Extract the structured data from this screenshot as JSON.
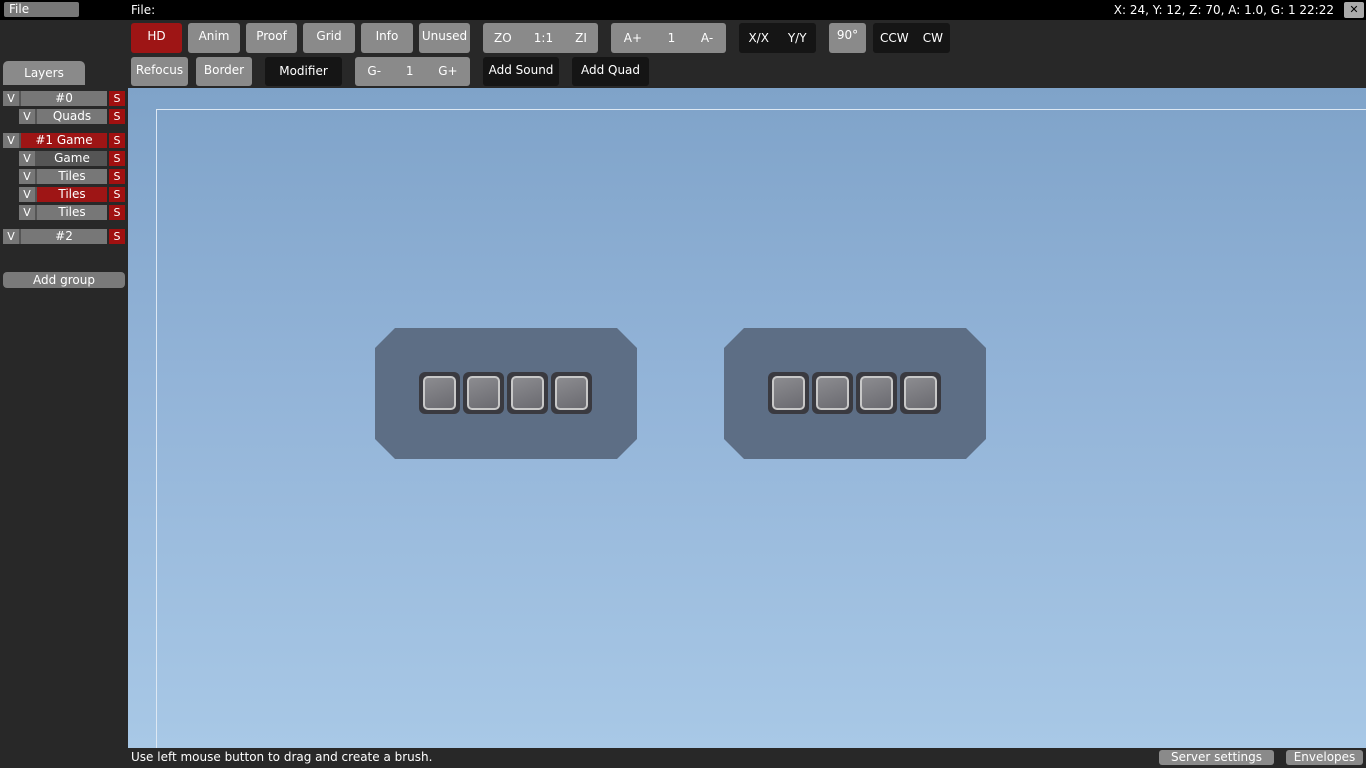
{
  "menubar": {
    "file_menu": "File",
    "file_label": "File:",
    "status": "X: 24, Y: 12, Z: 70, A: 1.0, G: 1  22:22",
    "close": "✕"
  },
  "toolbar": {
    "row1": {
      "hd": "HD",
      "anim": "Anim",
      "proof": "Proof",
      "grid": "Grid",
      "info": "Info",
      "unused": "Unused",
      "zoom_out": "ZO",
      "zoom_reset": "1:1",
      "zoom_in": "ZI",
      "anim_faster": "A+",
      "anim_speed": "1",
      "anim_slower": "A-",
      "flip_x": "X/X",
      "flip_y": "Y/Y",
      "rotate_90": "90°",
      "rotate_ccw": "CCW",
      "rotate_cw": "CW"
    },
    "row2": {
      "refocus": "Refocus",
      "border": "Border",
      "modifier": "Modifier",
      "grid_minus": "G-",
      "grid_value": "1",
      "grid_plus": "G+",
      "add_sound": "Add Sound",
      "add_quad": "Add Quad"
    }
  },
  "layers": {
    "tab": "Layers",
    "rows": [
      {
        "v": "V",
        "name": "#0",
        "s": "S"
      },
      {
        "v": "V",
        "name": "Quads",
        "s": "S"
      },
      {
        "v": "V",
        "name": "#1 Game",
        "s": "S"
      },
      {
        "v": "V",
        "name": "Game",
        "s": "S"
      },
      {
        "v": "V",
        "name": "Tiles",
        "s": "S"
      },
      {
        "v": "V",
        "name": "Tiles",
        "s": "S"
      },
      {
        "v": "V",
        "name": "Tiles",
        "s": "S"
      },
      {
        "v": "V",
        "name": "#2",
        "s": "S"
      }
    ],
    "add_group": "Add group"
  },
  "statusbar": {
    "text": "Use left mouse button to drag and create a brush.",
    "server_settings": "Server settings",
    "envelopes": "Envelopes"
  },
  "colors": {
    "active_red": "#9e1515",
    "button_grey": "#8a8a8a",
    "sky_top": "#7fa3c9",
    "sky_bottom": "#a8c8e6",
    "platform": "#5d6e85"
  }
}
